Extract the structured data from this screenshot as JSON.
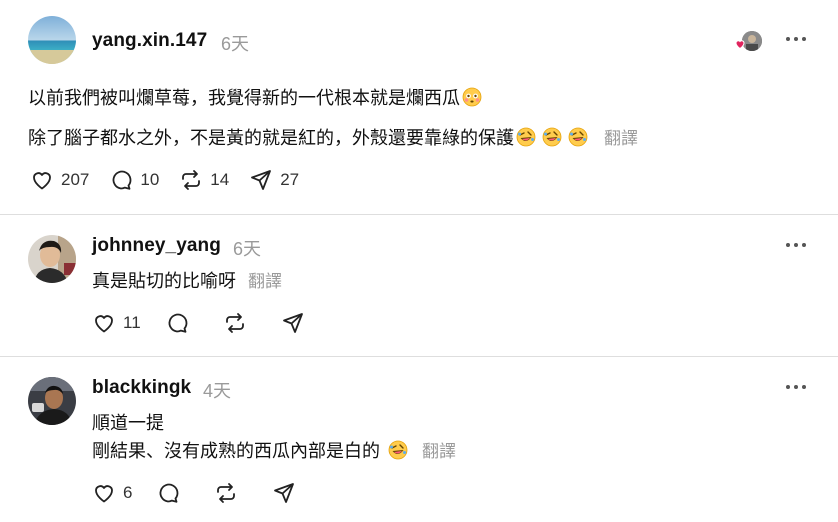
{
  "post": {
    "username": "yang.xin.147",
    "time": "6天",
    "line1": "以前我們被叫爛草莓，我覺得新的一代根本就是爛西瓜",
    "line2": "除了腦子都水之外，不是黃的就是紅的，外殼還要靠綠的保護",
    "translate": "翻譯",
    "likes": "207",
    "comments": "10",
    "reposts": "14",
    "shares": "27"
  },
  "replies": [
    {
      "username": "johnney_yang",
      "time": "6天",
      "line1": "真是貼切的比喻呀",
      "translate": "翻譯",
      "likes": "11"
    },
    {
      "username": "blackkingk",
      "time": "4天",
      "line1": "順道一提",
      "line2": "剛結果、沒有成熟的西瓜內部是白的",
      "translate": "翻譯",
      "likes": "6"
    }
  ],
  "icons": {
    "like": "heart-icon",
    "comment": "comment-icon",
    "repost": "repost-icon",
    "share": "share-icon",
    "more": "more-icon"
  },
  "colors": {
    "heart_badge": "#e0245e",
    "muted_text": "#9a9a9a"
  }
}
